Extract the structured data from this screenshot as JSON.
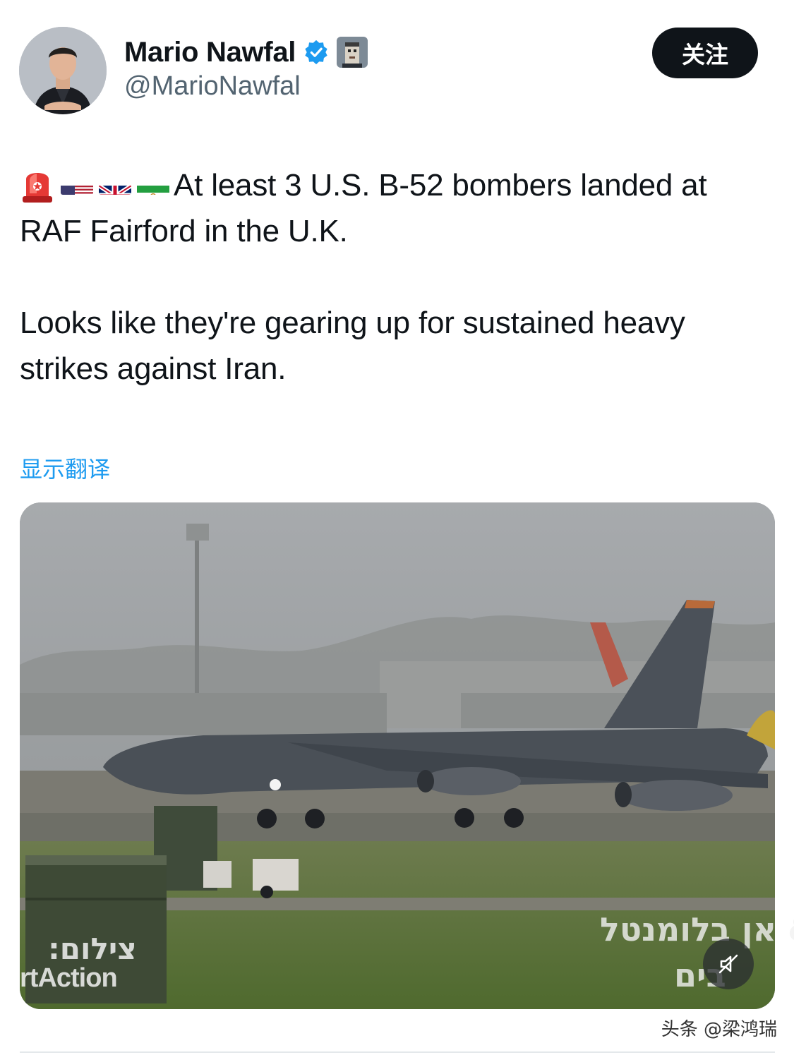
{
  "author": {
    "display_name": "Mario Nawfal",
    "handle": "@MarioNawfal",
    "verified_icon": "verified-badge-icon",
    "affiliate_icon": "pixel-avatar-affiliate-icon",
    "avatar": "profile-photo"
  },
  "follow_button": {
    "label": "关注"
  },
  "tweet": {
    "emojis": [
      "rotating-light-icon",
      "us-flag-icon",
      "uk-flag-icon",
      "iran-flag-icon"
    ],
    "line1": "At least 3 U.S. B-52 bombers landed at",
    "line2": "RAF Fairford in the U.K.",
    "line3": "Looks like they're gearing up for sustained heavy",
    "line4": "strikes against Iran."
  },
  "translate_link": "显示翻译",
  "media": {
    "type": "video",
    "description_icon": "b52-bomber-runway-video",
    "watermark_left_hebrew": "צילום:",
    "watermark_left_latin": "rtAction",
    "watermark_right_line1": "אן בלומנטל &",
    "watermark_right_line2": "בים",
    "mute_icon": "muted-speaker-icon"
  },
  "source_watermark": "头条 @梁鸿瑞",
  "colors": {
    "accent": "#1d9bf0",
    "text": "#0f1419",
    "muted": "#536471",
    "follow_bg": "#0f1419"
  }
}
